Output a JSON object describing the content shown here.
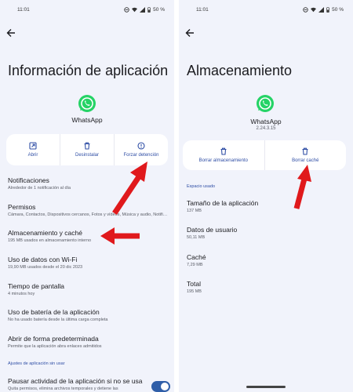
{
  "colors": {
    "background": "#f1f3fb",
    "accent": "#2f4ea5",
    "arrow": "#e0191c",
    "whatsapp": "#25d366"
  },
  "left": {
    "status": {
      "time": "11:01",
      "battery": "50 %"
    },
    "back_icon": "arrow-left-icon",
    "title": "Información de aplicación",
    "app_name": "WhatsApp",
    "actions": [
      {
        "label": "Abrir",
        "icon": "open-external-icon"
      },
      {
        "label": "Desinstalar",
        "icon": "trash-icon"
      },
      {
        "label": "Forzar detención",
        "icon": "info-alert-icon"
      }
    ],
    "rows": [
      {
        "title": "Notificaciones",
        "subtitle": "Alrededor de 1 notificación al día"
      },
      {
        "title": "Permisos",
        "subtitle": "Cámara, Contactos, Dispositivos cercanos, Fotos y vídeos, Música y audio, Notifi…"
      },
      {
        "title": "Almacenamiento y caché",
        "subtitle": "195 MB usados en almacenamiento interno"
      },
      {
        "title": "Uso de datos con Wi-Fi",
        "subtitle": "19,90 MB usados desde el 20 dic 2023"
      },
      {
        "title": "Tiempo de pantalla",
        "subtitle": "4 minutos hoy"
      },
      {
        "title": "Uso de batería de la aplicación",
        "subtitle": "No ha usado batería desde la última carga completa"
      },
      {
        "title": "Abrir de forma predeterminada",
        "subtitle": "Permite que la aplicación abra enlaces admitidos"
      }
    ],
    "section_label": "Ajustes de aplicación sin usar",
    "pause_row": {
      "title": "Pausar actividad de la aplicación si no se usa",
      "subtitle": "Quita permisos, elimina archivos temporales y detiene las",
      "toggle_on": true
    }
  },
  "right": {
    "status": {
      "time": "11:01",
      "battery": "50 %"
    },
    "back_icon": "arrow-left-icon",
    "title": "Almacenamiento",
    "app_name": "WhatsApp",
    "app_version": "2.24.3.15",
    "actions": [
      {
        "label": "Borrar almacenamiento",
        "icon": "trash-icon"
      },
      {
        "label": "Borrar caché",
        "icon": "trash-icon"
      }
    ],
    "section_label": "Espacio usado",
    "rows": [
      {
        "title": "Tamaño de la aplicación",
        "subtitle": "137 MB"
      },
      {
        "title": "Datos de usuario",
        "subtitle": "50,11 MB"
      },
      {
        "title": "Caché",
        "subtitle": "7,29 MB"
      },
      {
        "title": "Total",
        "subtitle": "195 MB"
      }
    ]
  }
}
